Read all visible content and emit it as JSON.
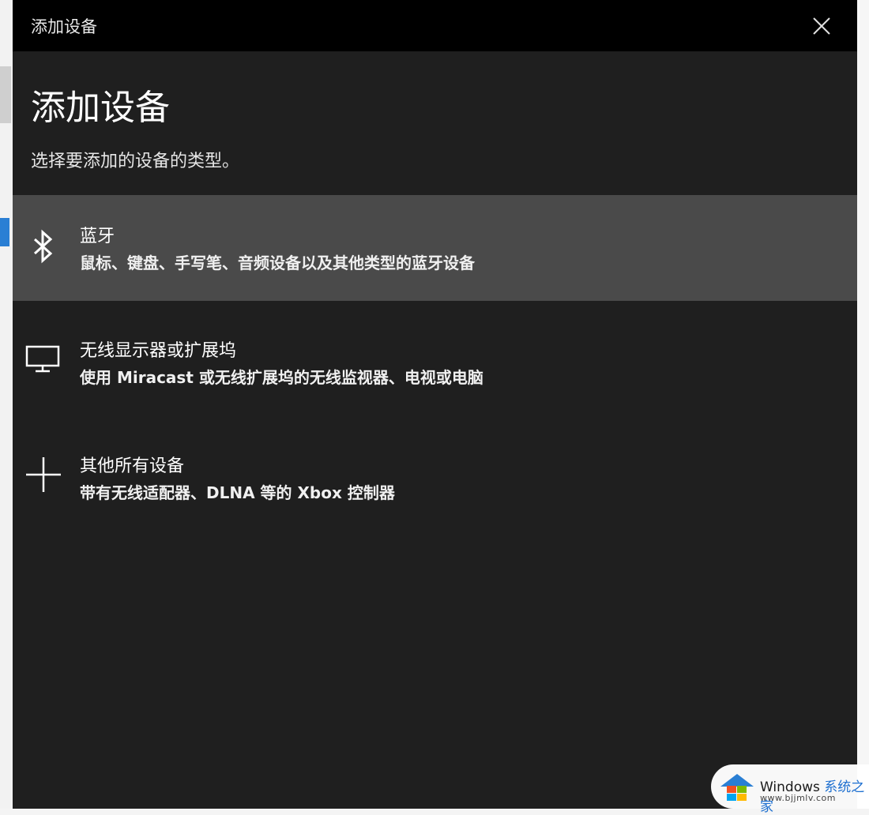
{
  "window": {
    "title": "添加设备",
    "close_icon": "close-icon"
  },
  "page": {
    "heading": "添加设备",
    "subheading": "选择要添加的设备的类型。"
  },
  "options": [
    {
      "icon": "bluetooth-icon",
      "label": "蓝牙",
      "description": "鼠标、键盘、手写笔、音频设备以及其他类型的蓝牙设备",
      "selected": true
    },
    {
      "icon": "monitor-icon",
      "label": "无线显示器或扩展坞",
      "description": "使用 Miracast 或无线扩展坞的无线监视器、电视或电脑",
      "selected": false
    },
    {
      "icon": "plus-icon",
      "label": "其他所有设备",
      "description": "带有无线适配器、DLNA 等的 Xbox 控制器",
      "selected": false
    }
  ],
  "watermark": {
    "brand": "Windows",
    "brand_cn": "系统之家",
    "url": "www.bjjmlv.com"
  },
  "colors": {
    "titlebar": "#000000",
    "dialog_background": "#1f1f1f",
    "selected_item": "#4a4a4a",
    "text": "#ffffff"
  }
}
